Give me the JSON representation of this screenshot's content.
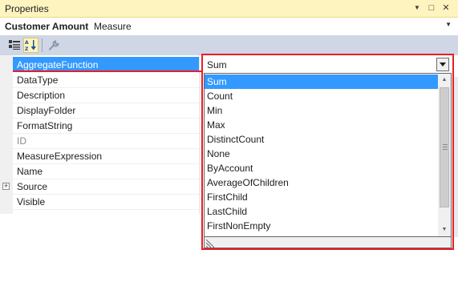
{
  "window": {
    "title": "Properties",
    "buttons": {
      "dropdown": "▼",
      "maximize": "□",
      "close": "✕"
    }
  },
  "object_selector": {
    "name": "Customer Amount",
    "type": "Measure"
  },
  "toolbar": {
    "buttons": [
      {
        "icon": "categorized-icon",
        "active": false
      },
      {
        "icon": "alphabetical-icon",
        "active": true
      },
      {
        "icon": "wrench-icon",
        "active": false
      }
    ]
  },
  "properties": [
    {
      "name": "AggregateFunction",
      "selected": true
    },
    {
      "name": "DataType"
    },
    {
      "name": "Description"
    },
    {
      "name": "DisplayFolder"
    },
    {
      "name": "FormatString"
    },
    {
      "name": "ID",
      "disabled": true
    },
    {
      "name": "MeasureExpression"
    },
    {
      "name": "Name"
    },
    {
      "name": "Source",
      "expandable": true,
      "expander": "+"
    },
    {
      "name": "Visible"
    }
  ],
  "dropdown": {
    "current_value": "Sum",
    "options": [
      "Sum",
      "Count",
      "Min",
      "Max",
      "DistinctCount",
      "None",
      "ByAccount",
      "AverageOfChildren",
      "FirstChild",
      "LastChild",
      "FirstNonEmpty"
    ],
    "highlighted": "Sum"
  },
  "colors": {
    "titlebar": "#fdf4bf",
    "toolbar": "#cfd6e5",
    "selection": "#3399ff",
    "annotation_red": "#e81e27"
  }
}
